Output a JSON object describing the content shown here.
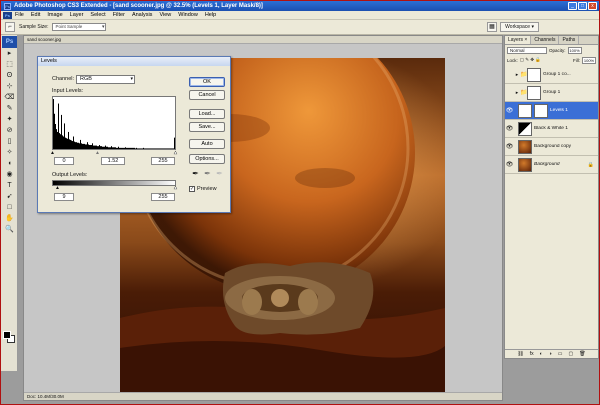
{
  "title_bar": {
    "title": "Adobe Photoshop CS3 Extended - [sand scooner.jpg @ 32.5% (Levels 1, Layer Mask/8)]",
    "app_badge": "Ps",
    "min": "_",
    "max": "□",
    "close": "x"
  },
  "menu": {
    "badge": "Ps",
    "items": [
      "File",
      "Edit",
      "Image",
      "Layer",
      "Select",
      "Filter",
      "Analysis",
      "View",
      "Window",
      "Help"
    ]
  },
  "options_bar": {
    "sample_size_label": "Sample Size:",
    "sample_size_value": "Point Sample",
    "workspace_label": "Workspace ▾"
  },
  "toolbox": {
    "logo": "Ps",
    "tools": [
      "▸",
      "⬚",
      "ʘ",
      "⊹",
      "⌫",
      "✎",
      "✦",
      "⊘",
      "▯",
      "✧",
      "◖",
      "◉",
      "T",
      "➹",
      "□",
      "✋",
      "🔍"
    ]
  },
  "document": {
    "title": "sand scooner.jpg",
    "status": "Doc: 10.4M/30.0M"
  },
  "levels_dialog": {
    "title": "Levels",
    "channel_label": "Channel:",
    "channel_value": "RGB",
    "input_levels_label": "Input Levels:",
    "input_black": "0",
    "input_gamma": "1.52",
    "input_white": "255",
    "output_levels_label": "Output Levels:",
    "output_black": "9",
    "output_white": "255",
    "buttons": {
      "ok": "OK",
      "cancel": "Cancel",
      "load": "Load...",
      "save": "Save...",
      "auto": "Auto",
      "options": "Options..."
    },
    "preview_label": "Preview",
    "preview_checked": true,
    "histogram": [
      88,
      62,
      44,
      35,
      30,
      80,
      28,
      26,
      60,
      24,
      22,
      45,
      20,
      19,
      18,
      30,
      17,
      16,
      15,
      14,
      22,
      13,
      12,
      12,
      11,
      11,
      10,
      16,
      10,
      9,
      9,
      9,
      8,
      8,
      12,
      8,
      7,
      7,
      7,
      10,
      6,
      6,
      6,
      6,
      5,
      5,
      7,
      5,
      5,
      4,
      4,
      4,
      6,
      4,
      4,
      3,
      3,
      3,
      5,
      3,
      3,
      3,
      3,
      2,
      2,
      4,
      2,
      2,
      2,
      2,
      2,
      2,
      3,
      2,
      2,
      2,
      2,
      2,
      2,
      2,
      2,
      2,
      1,
      2,
      1,
      1,
      1,
      1,
      1,
      1,
      2,
      1,
      1,
      1,
      1,
      1,
      1,
      1,
      1,
      1,
      1,
      1,
      1,
      1,
      1,
      1,
      1,
      1,
      1,
      1,
      1,
      1,
      1,
      1,
      1,
      1,
      1,
      1,
      1,
      1,
      1,
      20
    ]
  },
  "layers_panel": {
    "tabs": [
      "Layers ×",
      "Channels",
      "Paths"
    ],
    "blend_mode": "Normal",
    "opacity_label": "Opacity:",
    "opacity_value": "100%",
    "lock_label": "Lock:",
    "fill_label": "Fill:",
    "fill_value": "100%",
    "layers": [
      {
        "name": "Group 1 co...",
        "type": "group",
        "visible": false
      },
      {
        "name": "Group 1",
        "type": "group",
        "visible": false
      },
      {
        "name": "Levels 1",
        "type": "adjustment",
        "visible": true,
        "selected": true
      },
      {
        "name": "Black & White 1",
        "type": "adjustment",
        "visible": true
      },
      {
        "name": "Background copy",
        "type": "image",
        "visible": true
      },
      {
        "name": "Background",
        "type": "image",
        "visible": true,
        "locked": true
      }
    ],
    "footer_icons": [
      "⛓",
      "fx",
      "◐",
      "◑",
      "▭",
      "▢",
      "🗑"
    ]
  },
  "colors": {
    "title_bar": "#1b4fb0",
    "selected_layer": "#3b6fd6",
    "planet": "#c8641c",
    "sand": "#6b2a0a"
  }
}
